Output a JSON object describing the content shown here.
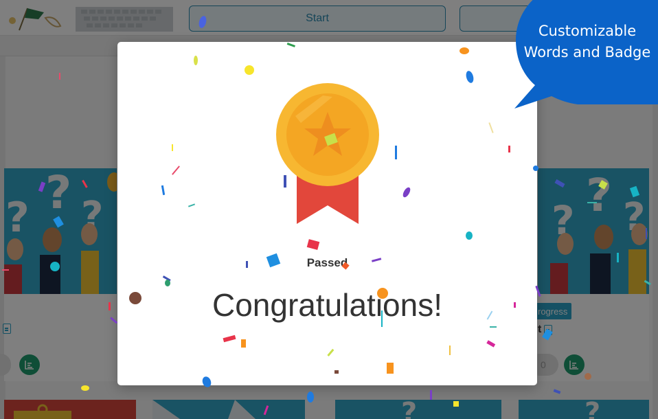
{
  "toolbar": {
    "start_label": "Start",
    "second_label": ""
  },
  "cards": {
    "right_badge": "rogress",
    "right_line_text": "t",
    "right_count": "0"
  },
  "modal": {
    "status": "Passed",
    "heading": "Congratulations!"
  },
  "promo": {
    "line1": "Customizable",
    "line2": "Words and Badge"
  },
  "colors": {
    "accent": "#2aa3c8",
    "promo_blue": "#0b63c8",
    "medal_gold": "#f7b731",
    "ribbon_red": "#e2473b",
    "chart_green": "#1e9d6f"
  },
  "icons": {
    "medal": "medal-icon",
    "document": "document-icon",
    "chart": "bar-chart-icon"
  }
}
